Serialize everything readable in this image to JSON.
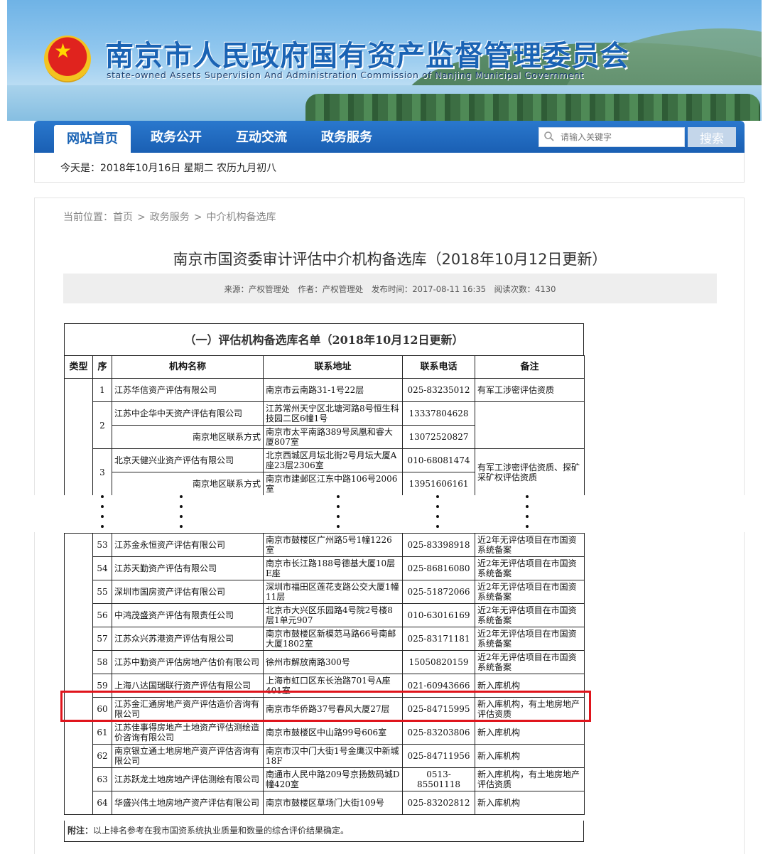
{
  "header": {
    "site_title": "南京市人民政府国有资产监督管理委员会",
    "site_subtitle": "state-owned Assets Supervision And Administration Commission of Nanjing Municipal Government"
  },
  "nav": {
    "items": [
      "网站首页",
      "政务公开",
      "互动交流",
      "政务服务"
    ],
    "search_placeholder": "请输入关键字",
    "search_button": "搜索"
  },
  "datebar": {
    "text": "今天是：2018年10月16日  星期二    农历九月初八"
  },
  "breadcrumb": {
    "items": [
      "当前位置：首页",
      "政务服务",
      "中介机构备选库"
    ],
    "separator": ">"
  },
  "article": {
    "title": "南京市国资委审计评估中介机构备选库（2018年10月12日更新）",
    "meta": [
      "来源：产权管理处",
      "作者：产权管理处",
      "发布时间：2017-08-11 16:35",
      "阅读次数：4130"
    ]
  },
  "table": {
    "title": "（一）评估机构备选库名单（2018年10月12日更新）",
    "headers": [
      "类型",
      "序",
      "机构名称",
      "联系地址",
      "联系电话",
      "备注"
    ],
    "top_rows": [
      {
        "seq": "1",
        "name": "江苏华信资产评估有限公司",
        "addr": "南京市云南路31-1号22层",
        "tel": "025-83235012",
        "note": "有军工涉密评估资质"
      },
      {
        "seq": "2",
        "name": "江苏中企华中天资产评估有限公司",
        "addr": "江苏常州天宁区北塘河路8号恒生科技园二区6幢1号",
        "tel": "13337804628",
        "note": ""
      },
      {
        "seq": "",
        "name": "南京地区联系方式",
        "addr": "南京市太平南路389号凤凰和睿大厦807室",
        "tel": "13072520827",
        "note": ""
      },
      {
        "seq": "3",
        "name": "北京天健兴业资产评估有限公司",
        "addr": "北京西城区月坛北街2号月坛大厦A座23层2306室",
        "tel": "010-68081474",
        "note": "有军工涉密评估资质、探矿采矿权评估资质"
      },
      {
        "seq": "",
        "name": "南京地区联系方式",
        "addr": "南京市建邺区江东中路106号2006室",
        "tel": "13951606161",
        "note": ""
      }
    ],
    "bottom_rows": [
      {
        "seq": "53",
        "name": "江苏金永恒资产评估有限公司",
        "addr": "南京市鼓楼区广州路5号1幢1226室",
        "tel": "025-83398918",
        "note": "近2年无评估项目在市国资系统备案"
      },
      {
        "seq": "54",
        "name": "江苏天勤资产评估有限公司",
        "addr": "南京市长江路188号德基大厦10层E座",
        "tel": "025-86816080",
        "note": "近2年无评估项目在市国资系统备案"
      },
      {
        "seq": "55",
        "name": "深圳市国房资产评估有限公司",
        "addr": "深圳市福田区莲花支路公交大厦1幢11层",
        "tel": "025-51872066",
        "note": "近2年无评估项目在市国资系统备案"
      },
      {
        "seq": "56",
        "name": "中鸿茂盛资产评估有限责任公司",
        "addr": "北京市大兴区乐园路4号院2号楼8层1单元907",
        "tel": "010-63016169",
        "note": "近2年无评估项目在市国资系统备案"
      },
      {
        "seq": "57",
        "name": "江苏众兴苏港资产评估有限公司",
        "addr": "南京市鼓楼区新模范马路66号南邮大厦1802室",
        "tel": "025-83171181",
        "note": "近2年无评估项目在市国资系统备案"
      },
      {
        "seq": "58",
        "name": "江苏中勤资产评估房地产估价有限公司",
        "addr": "徐州市解放南路300号",
        "tel": "15050820159",
        "note": "近2年无评估项目在市国资系统备案"
      },
      {
        "seq": "59",
        "name": "上海八达国瑞联行资产评估有限公司",
        "addr": "上海市虹口区东长治路701号A座401室",
        "tel": "021-60943666",
        "note": "新入库机构"
      },
      {
        "seq": "60",
        "name": "江苏金汇通房地产资产评估造价咨询有限公司",
        "addr": "南京市华侨路37号春风大厦27层",
        "tel": "025-84715995",
        "note": "新入库机构，有土地房地产评估资质"
      },
      {
        "seq": "61",
        "name": "江苏佳事得房地产土地资产评估测绘造价咨询有限公司",
        "addr": "南京市鼓楼区中山路99号606室",
        "tel": "025-83203806",
        "note": "新入库机构"
      },
      {
        "seq": "62",
        "name": "南京银立通土地房地产资产评估咨询有限公司",
        "addr": "南京市汉中门大街1号金鹰汉中新城18F",
        "tel": "025-84711956",
        "note": "新入库机构"
      },
      {
        "seq": "63",
        "name": "江苏跃龙土地房地产评估测绘有限公司",
        "addr": "南通市人民中路209号京扬数码城D幢420室",
        "tel": "0513-85501118",
        "note": "新入库机构，有土地房地产评估资质"
      },
      {
        "seq": "64",
        "name": "华盛兴伟土地房地产资产评估有限公司",
        "addr": "南京市鼓楼区草场门大街109号",
        "tel": "025-83202812",
        "note": "新入库机构"
      }
    ],
    "footnote_label": "附注：",
    "footnote_text": "以上排名参考在我市国资系统执业质量和数量的综合评价结果确定。"
  }
}
